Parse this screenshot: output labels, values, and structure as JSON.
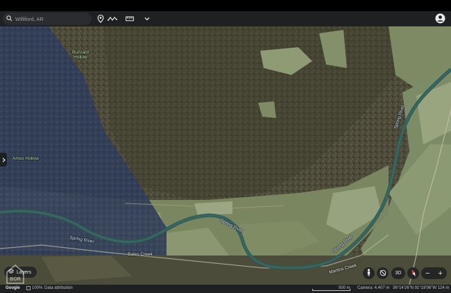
{
  "search": {
    "value": "Williford, AR",
    "icon": "search-icon"
  },
  "toolbar": {
    "icons": [
      "location-pin-icon",
      "path-icon",
      "measure-icon",
      "chevron-down-icon",
      "account-icon"
    ]
  },
  "map": {
    "labels": {
      "buzzard_hollow": "Buzzard\nHollow",
      "amos_hollow": "Amos Hollow",
      "spring_river_left": "Spring River",
      "spring_river_mid": "Spring River",
      "spring_river_right1": "Spring River",
      "spring_river_right2": "Spring River",
      "bates_creek": "Bates Creek",
      "martins_creek": "Martins Creek"
    }
  },
  "controls": {
    "layers_label": "Layers",
    "view_3d_label": "3D",
    "zoom_out": "−",
    "zoom_in": "+"
  },
  "status": {
    "google": "Google",
    "zoom_percent": "100%",
    "data_attribution": "Data attribution",
    "scale": "500 m",
    "camera": "Camera: 4,407 m",
    "coordinates": "36°14'26\"N 91°19'06\"W 124 m"
  },
  "colors": {
    "toolbar": "#1f2022",
    "forest": "#4a4a36",
    "field": "#8a9a72",
    "river": "#2f5a55",
    "shadow_blue": "#2c3a5a",
    "compass_red": "#e84335"
  }
}
